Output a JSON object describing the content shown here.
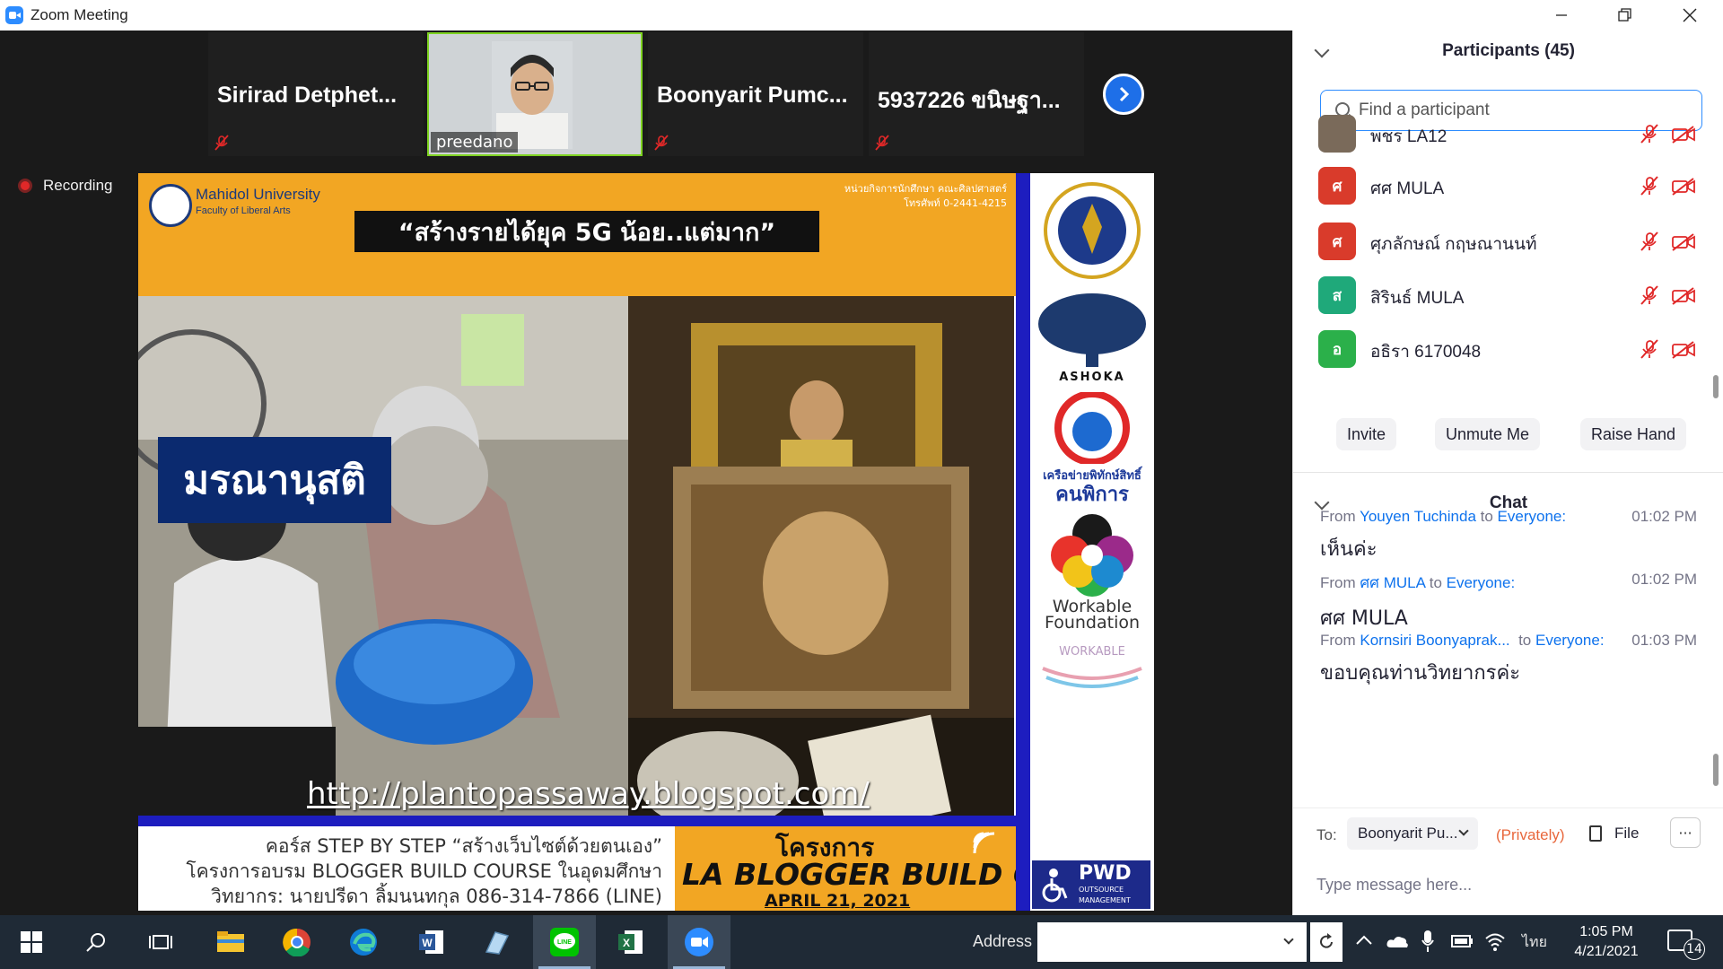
{
  "window": {
    "title": "Zoom Meeting",
    "controls": [
      "minimize",
      "restore",
      "close"
    ]
  },
  "strip": {
    "tiles": [
      {
        "name": "Sirirad  Detphet...",
        "muted": true
      },
      {
        "name": "preedano",
        "video": true
      },
      {
        "name": "Boonyarit  Pumc...",
        "muted": true
      },
      {
        "name": "5937226 ขนิษฐา...",
        "muted": true
      }
    ]
  },
  "recording": {
    "label": "Recording"
  },
  "slide": {
    "university": "Mahidol University",
    "faculty": "Faculty of Liberal Arts",
    "contact_line1": "หน่วยกิจการนักศึกษา  คณะศิลปศาสตร์",
    "contact_line2": "โทรศัพท์  0-2441-4215",
    "headline": "“สร้างรายได้ยุค 5G น้อย..แต่มาก”",
    "banner": "มรณานุสติ",
    "url": "http://plantopassaway.blogspot.com/",
    "course_lines": [
      "คอร์ส STEP BY STEP “สร้างเว็บไซต์ด้วยตนเอง”",
      "โครงการอบรม BLOGGER BUILD COURSE ในอุดมศึกษา",
      "วิทยากร: นายปรีดา ลิ้มนนทกุล 086-314-7866 (LINE)"
    ],
    "project_label": "โครงการ",
    "course_title": "LA  BLOGGER  BUILD  COURSE",
    "date": "APRIL 21, 2021",
    "sponsors": {
      "ashoka": "ASHOKA",
      "network_line1": "เครือข่ายพิทักษ์สิทธิ์",
      "network_line2": "คนพิการ",
      "workable_line1": "Workable",
      "workable_line2": "Foundation",
      "workable_small": "WORKABLE",
      "pwd_big": "PWD",
      "pwd_small1": "OUTSOURCE",
      "pwd_small2": "MANAGEMENT"
    }
  },
  "participants": {
    "title": "Participants (45)",
    "search_placeholder": "Find a participant",
    "list": [
      {
        "initial": "",
        "name": "พชร LA12",
        "color": "#7a6a5a"
      },
      {
        "initial": "ศ",
        "name": "ศศ MULA",
        "color": "#d93b2b"
      },
      {
        "initial": "ศ",
        "name": "ศุภลักษณ์ กฤษณานนท์",
        "color": "#d93b2b"
      },
      {
        "initial": "ส",
        "name": "สิรินธ์ MULA",
        "color": "#1fa97a"
      },
      {
        "initial": "อ",
        "name": "อธิรา 6170048",
        "color": "#2bb04a"
      }
    ],
    "buttons": {
      "invite": "Invite",
      "unmute": "Unmute Me",
      "raise_hand": "Raise Hand"
    }
  },
  "chat": {
    "title": "Chat",
    "messages": [
      {
        "from_label": "From ",
        "sender": "Youyen Tuchinda",
        "to_label": " to ",
        "recipient": "Everyone:",
        "time": "01:02 PM",
        "text": "เห็นค่ะ"
      },
      {
        "from_label": "From ",
        "sender": "ศศ MULA",
        "to_label": " to ",
        "recipient": "Everyone:",
        "time": "01:02 PM",
        "text": "ศศ MULA"
      },
      {
        "from_label": "From ",
        "sender": "Kornsiri Boonyaprak...",
        "to_label": "  to ",
        "recipient": "Everyone:",
        "time": "01:03 PM",
        "text": "ขอบคุณท่านวิทยากรค่ะ"
      }
    ],
    "to_label": "To:",
    "to_value": "Boonyarit Pu...",
    "privately": "(Privately)",
    "file_label": "File",
    "more_label": "···",
    "input_placeholder": "Type message here..."
  },
  "taskbar": {
    "address_label": "Address",
    "address_value": "",
    "clock_time": "1:05 PM",
    "clock_date": "4/21/2021",
    "language": "ไทย",
    "notification_count": "14",
    "apps": [
      "start",
      "search",
      "task-view",
      "file-explorer",
      "chrome",
      "edge",
      "word",
      "notepad",
      "line",
      "excel",
      "zoom"
    ]
  },
  "colors": {
    "zoom_blue": "#2d8cff",
    "link_blue": "#0e72ed",
    "private_orange": "#e8673c",
    "slide_orange": "#f2a623",
    "slide_navy": "#0b2a6f",
    "taskbar": "#1f2a36"
  }
}
